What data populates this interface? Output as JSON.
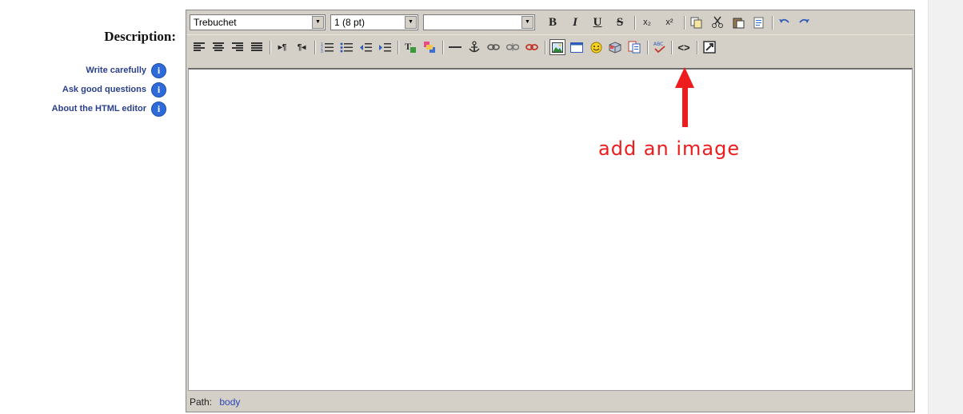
{
  "labels": {
    "description": "Description:",
    "help_links": [
      "Write carefully",
      "Ask good questions",
      "About the HTML editor"
    ]
  },
  "toolbar": {
    "font_family": "Trebuchet",
    "font_size": "1 (8 pt)",
    "format_value": "",
    "bold": "B",
    "italic": "I",
    "underline": "U",
    "strike": "S",
    "subscript": "x₂",
    "superscript": "x²"
  },
  "pathbar": {
    "label": "Path:",
    "link": "body"
  },
  "annotation": {
    "text": "add an image"
  },
  "colors": {
    "annotation": "#ee1c1c",
    "toolbar_bg": "#d4d0c8",
    "link": "#2a3f8c"
  }
}
